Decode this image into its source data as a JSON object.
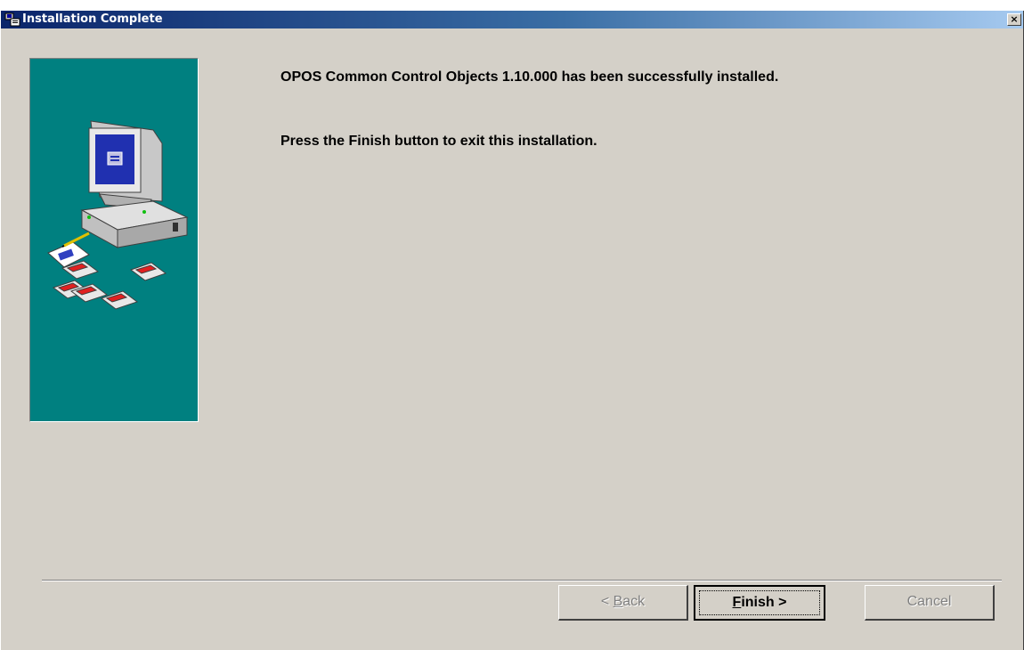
{
  "window": {
    "title": "Installation Complete",
    "close_label": "×"
  },
  "content": {
    "message1": "OPOS Common Control Objects 1.10.000 has been successfully installed.",
    "message2": "Press the Finish button to exit this installation."
  },
  "buttons": {
    "back": {
      "accel": "B",
      "rest": "ack",
      "prefix": "< ",
      "enabled": false
    },
    "finish": {
      "accel": "F",
      "rest": "inish",
      "suffix": " >",
      "default": true
    },
    "cancel": {
      "label": "Cancel",
      "enabled": false
    }
  },
  "colors": {
    "titlebar_start": "#0a246a",
    "titlebar_end": "#a6caf0",
    "dialog_bg": "#d4d0c8",
    "side_panel": "#008080"
  },
  "icons": [
    "setup-icon",
    "close-icon",
    "computer-illustration"
  ]
}
